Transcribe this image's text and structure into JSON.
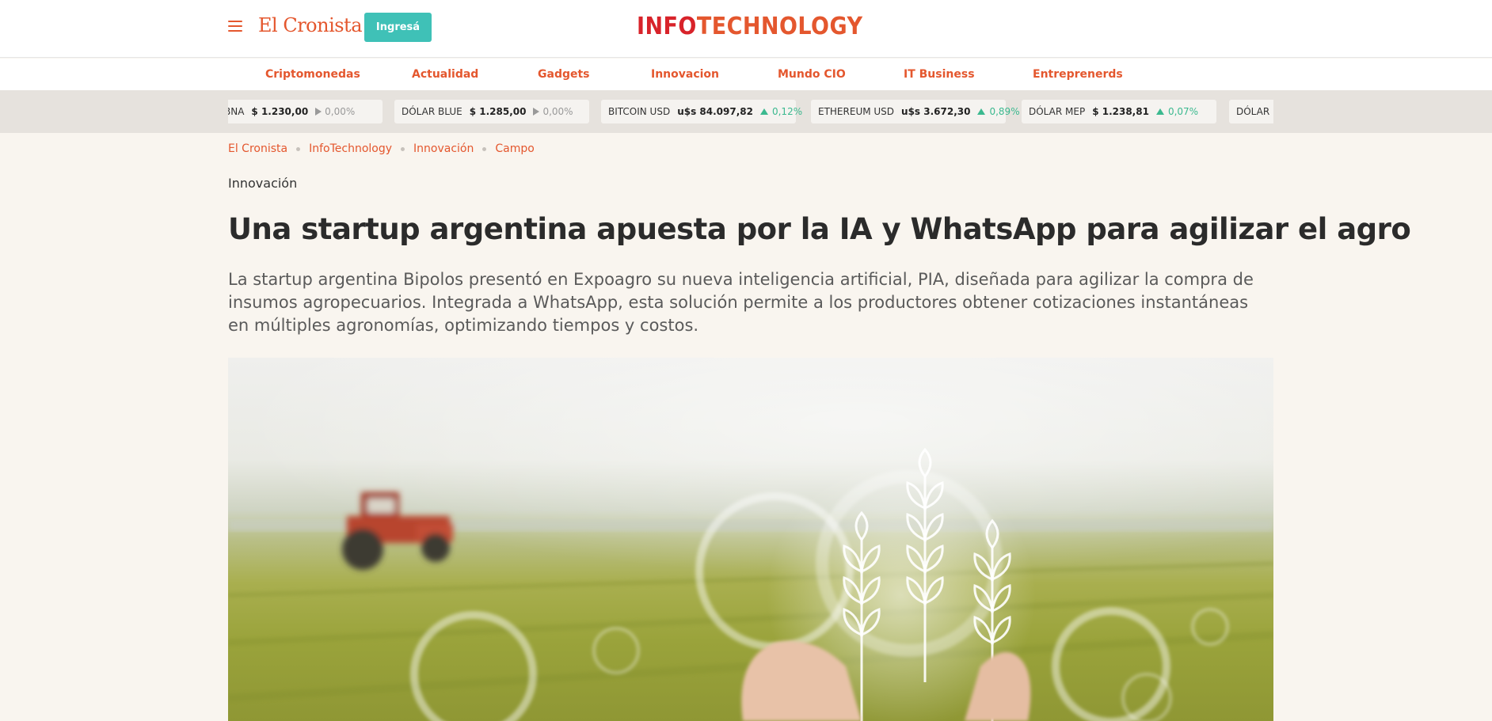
{
  "header": {
    "brand": "El Cronista",
    "login_label": "Ingresá",
    "logo_part1": "INFO",
    "logo_part2": "TECHNOLOGY"
  },
  "nav": {
    "items": [
      {
        "label": "Criptomonedas"
      },
      {
        "label": "Actualidad"
      },
      {
        "label": "Gadgets"
      },
      {
        "label": "Innovacion"
      },
      {
        "label": "Mundo CIO"
      },
      {
        "label": "IT Business"
      },
      {
        "label": "Entreprenerds"
      }
    ]
  },
  "ticker": {
    "items": [
      {
        "name": "BNA",
        "value": "$ 1.230,00",
        "change": "0,00%",
        "direction": "flat"
      },
      {
        "name": "DÓLAR BLUE",
        "value": "$ 1.285,00",
        "change": "0,00%",
        "direction": "flat"
      },
      {
        "name": "BITCOIN USD",
        "value": "u$s 84.097,82",
        "change": "0,12%",
        "direction": "up"
      },
      {
        "name": "ETHEREUM USD",
        "value": "u$s 3.672,30",
        "change": "0,89%",
        "direction": "up"
      },
      {
        "name": "DÓLAR MEP",
        "value": "$ 1.238,81",
        "change": "0,07%",
        "direction": "up"
      },
      {
        "name": "DÓLAR M",
        "value": "",
        "change": "",
        "direction": "flat"
      }
    ]
  },
  "breadcrumb": [
    "El Cronista",
    "InfoTechnology",
    "Innovación",
    "Campo"
  ],
  "article": {
    "section": "Innovación",
    "title": "Una startup argentina apuesta por la IA y WhatsApp para agilizar el agro",
    "summary": "La startup argentina Bipolos presentó en Expoagro su nueva inteligencia artificial, PIA, diseñada para agilizar la compra de insumos agropecuarios. Integrada a WhatsApp, esta solución permite a los productores obtener cotizaciones instantáneas en múltiples agronomías, optimizando tiempos y costos."
  },
  "colors": {
    "accent": "#e4572e",
    "logo_red": "#d8232a",
    "button_teal": "#3fc1b7",
    "up_green": "#3bb98f",
    "background": "#f9f5ef"
  }
}
